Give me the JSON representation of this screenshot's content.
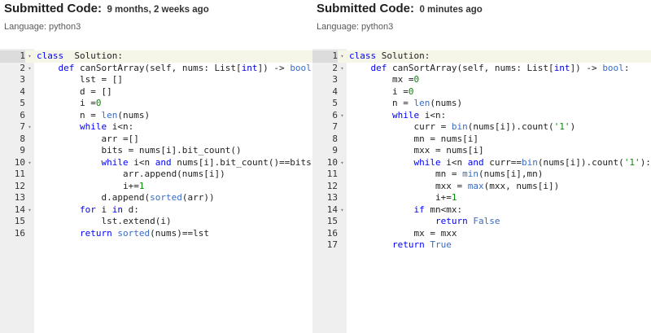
{
  "left": {
    "title": "Submitted Code:",
    "timestamp": "9 months, 2 weeks ago",
    "language": "Language: python3",
    "lines": [
      {
        "n": "1",
        "fold": true,
        "tokens": [
          [
            "kw",
            "class"
          ],
          [
            "",
            "  Solution:"
          ]
        ]
      },
      {
        "n": "2",
        "fold": true,
        "tokens": [
          [
            "",
            "    "
          ],
          [
            "kw",
            "def"
          ],
          [
            "",
            " canSortArray(self, nums: List["
          ],
          [
            "ty",
            "int"
          ],
          [
            "",
            "]) -> "
          ],
          [
            "bi",
            "bool"
          ],
          [
            "",
            ":"
          ]
        ]
      },
      {
        "n": "3",
        "fold": false,
        "tokens": [
          [
            "",
            "        lst = []"
          ]
        ]
      },
      {
        "n": "4",
        "fold": false,
        "tokens": [
          [
            "",
            "        d = []"
          ]
        ]
      },
      {
        "n": "5",
        "fold": false,
        "tokens": [
          [
            "",
            "        i ="
          ],
          [
            "num",
            "0"
          ]
        ]
      },
      {
        "n": "6",
        "fold": false,
        "tokens": [
          [
            "",
            "        n = "
          ],
          [
            "bi",
            "len"
          ],
          [
            "",
            "(nums)"
          ]
        ]
      },
      {
        "n": "7",
        "fold": true,
        "tokens": [
          [
            "",
            "        "
          ],
          [
            "kw",
            "while"
          ],
          [
            "",
            " i<n:"
          ]
        ]
      },
      {
        "n": "8",
        "fold": false,
        "tokens": [
          [
            "",
            "            arr =[]"
          ]
        ]
      },
      {
        "n": "9",
        "fold": false,
        "tokens": [
          [
            "",
            "            bits = nums[i].bit_count()"
          ]
        ]
      },
      {
        "n": "10",
        "fold": true,
        "tokens": [
          [
            "",
            "            "
          ],
          [
            "kw",
            "while"
          ],
          [
            "",
            " i<n "
          ],
          [
            "kw",
            "and"
          ],
          [
            "",
            " nums[i].bit_count()==bits:"
          ]
        ]
      },
      {
        "n": "11",
        "fold": false,
        "tokens": [
          [
            "",
            "                arr.append(nums[i])"
          ]
        ]
      },
      {
        "n": "12",
        "fold": false,
        "tokens": [
          [
            "",
            "                i+="
          ],
          [
            "num",
            "1"
          ]
        ]
      },
      {
        "n": "13",
        "fold": false,
        "tokens": [
          [
            "",
            "            d.append("
          ],
          [
            "bi",
            "sorted"
          ],
          [
            "",
            "(arr))"
          ]
        ]
      },
      {
        "n": "14",
        "fold": true,
        "tokens": [
          [
            "",
            "        "
          ],
          [
            "kw",
            "for"
          ],
          [
            "",
            " i "
          ],
          [
            "kw",
            "in"
          ],
          [
            "",
            " d:"
          ]
        ]
      },
      {
        "n": "15",
        "fold": false,
        "tokens": [
          [
            "",
            "            lst.extend(i)"
          ]
        ]
      },
      {
        "n": "16",
        "fold": false,
        "tokens": [
          [
            "",
            "        "
          ],
          [
            "kw",
            "return"
          ],
          [
            "",
            " "
          ],
          [
            "bi",
            "sorted"
          ],
          [
            "",
            "(nums)==lst"
          ]
        ]
      }
    ]
  },
  "right": {
    "title": "Submitted Code:",
    "timestamp": "0 minutes ago",
    "language": "Language: python3",
    "lines": [
      {
        "n": "1",
        "fold": true,
        "tokens": [
          [
            "kw",
            "class"
          ],
          [
            "",
            " Solution:"
          ]
        ]
      },
      {
        "n": "2",
        "fold": true,
        "tokens": [
          [
            "",
            "    "
          ],
          [
            "kw",
            "def"
          ],
          [
            "",
            " canSortArray(self, nums: List["
          ],
          [
            "ty",
            "int"
          ],
          [
            "",
            "]) -> "
          ],
          [
            "bi",
            "bool"
          ],
          [
            "",
            ":"
          ]
        ]
      },
      {
        "n": "3",
        "fold": false,
        "tokens": [
          [
            "",
            "        mx ="
          ],
          [
            "num",
            "0"
          ]
        ]
      },
      {
        "n": "4",
        "fold": false,
        "tokens": [
          [
            "",
            "        i ="
          ],
          [
            "num",
            "0"
          ]
        ]
      },
      {
        "n": "5",
        "fold": false,
        "tokens": [
          [
            "",
            "        n = "
          ],
          [
            "bi",
            "len"
          ],
          [
            "",
            "(nums)"
          ]
        ]
      },
      {
        "n": "6",
        "fold": true,
        "tokens": [
          [
            "",
            "        "
          ],
          [
            "kw",
            "while"
          ],
          [
            "",
            " i<n:"
          ]
        ]
      },
      {
        "n": "7",
        "fold": false,
        "tokens": [
          [
            "",
            "            curr = "
          ],
          [
            "bi",
            "bin"
          ],
          [
            "",
            "(nums[i]).count("
          ],
          [
            "str",
            "'1'"
          ],
          [
            "",
            ")"
          ]
        ]
      },
      {
        "n": "8",
        "fold": false,
        "tokens": [
          [
            "",
            "            mn = nums[i]"
          ]
        ]
      },
      {
        "n": "9",
        "fold": false,
        "tokens": [
          [
            "",
            "            mxx = nums[i]"
          ]
        ]
      },
      {
        "n": "10",
        "fold": true,
        "tokens": [
          [
            "",
            "            "
          ],
          [
            "kw",
            "while"
          ],
          [
            "",
            " i<n "
          ],
          [
            "kw",
            "and"
          ],
          [
            "",
            " curr=="
          ],
          [
            "bi",
            "bin"
          ],
          [
            "",
            "(nums[i]).count("
          ],
          [
            "str",
            "'1'"
          ],
          [
            "",
            "):"
          ]
        ]
      },
      {
        "n": "11",
        "fold": false,
        "tokens": [
          [
            "",
            "                mn = "
          ],
          [
            "bi",
            "min"
          ],
          [
            "",
            "(nums[i],mn)"
          ]
        ]
      },
      {
        "n": "12",
        "fold": false,
        "tokens": [
          [
            "",
            "                mxx = "
          ],
          [
            "bi",
            "max"
          ],
          [
            "",
            "(mxx, nums[i])"
          ]
        ]
      },
      {
        "n": "13",
        "fold": false,
        "tokens": [
          [
            "",
            "                i+="
          ],
          [
            "num",
            "1"
          ]
        ]
      },
      {
        "n": "14",
        "fold": true,
        "tokens": [
          [
            "",
            "            "
          ],
          [
            "kw",
            "if"
          ],
          [
            "",
            " mn<mx:"
          ]
        ]
      },
      {
        "n": "15",
        "fold": false,
        "tokens": [
          [
            "",
            "                "
          ],
          [
            "kw",
            "return"
          ],
          [
            "",
            " "
          ],
          [
            "bi",
            "False"
          ]
        ]
      },
      {
        "n": "16",
        "fold": false,
        "tokens": [
          [
            "",
            "            mx = mxx"
          ]
        ]
      },
      {
        "n": "17",
        "fold": false,
        "tokens": [
          [
            "",
            "        "
          ],
          [
            "kw",
            "return"
          ],
          [
            "",
            " "
          ],
          [
            "bi",
            "True"
          ]
        ]
      }
    ]
  }
}
